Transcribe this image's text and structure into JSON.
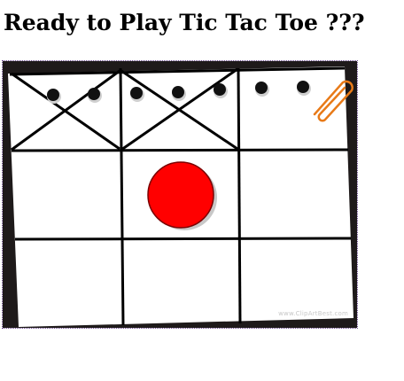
{
  "page": {
    "title": "Ready to Play Tic Tac Toe ???"
  },
  "board": {
    "rows": 3,
    "columns": 3,
    "cells": [
      [
        "X",
        "X",
        ""
      ],
      [
        "",
        "O",
        ""
      ],
      [
        "",
        "",
        ""
      ]
    ],
    "o_color": "#ff0000",
    "grid_color": "#000000",
    "paper_color": "#ffffff",
    "frame_color": "#1e1a1a",
    "paperclip_color": "#e87a18",
    "watermark": "www.ClipArtBest.com"
  },
  "icons": {
    "binder_holes": "binder-hole-icon",
    "paperclip": "paperclip-icon",
    "o_mark": "o-mark-icon",
    "x_mark": "x-mark-icon"
  }
}
